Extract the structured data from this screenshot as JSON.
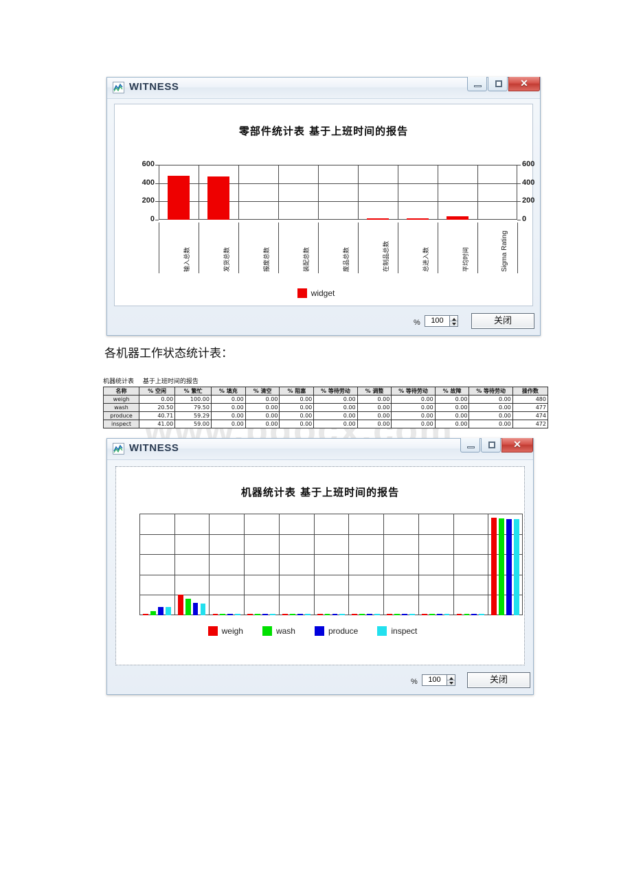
{
  "watermark": "www.bdocx.com",
  "window1": {
    "title": "WITNESS",
    "app_icon": "witness-chart-icon",
    "minimize_label": "",
    "maximize_label": "",
    "close_label": "✕",
    "chart_title": "零部件统计表  基于上班时间的报告",
    "percent_label": "%",
    "zoom_value": "100",
    "close_button_label": "关闭"
  },
  "caption_between": "各机器工作状态统计表：",
  "table": {
    "title_main": "机器统计表",
    "title_sub": "基于上班时间的报告",
    "columns": [
      "名称",
      "% 空闲",
      "% 繁忙",
      "% 填充",
      "% 清空",
      "% 阻塞",
      "% 等待劳动",
      "% 调整",
      "% 等待劳动",
      "% 故障",
      "% 等待劳动",
      "操作数"
    ],
    "rows": [
      {
        "name": "weigh",
        "values": [
          "0.00",
          "100.00",
          "0.00",
          "0.00",
          "0.00",
          "0.00",
          "0.00",
          "0.00",
          "0.00",
          "0.00",
          "480"
        ]
      },
      {
        "name": "wash",
        "values": [
          "20.50",
          "79.50",
          "0.00",
          "0.00",
          "0.00",
          "0.00",
          "0.00",
          "0.00",
          "0.00",
          "0.00",
          "477"
        ]
      },
      {
        "name": "produce",
        "values": [
          "40.71",
          "59.29",
          "0.00",
          "0.00",
          "0.00",
          "0.00",
          "0.00",
          "0.00",
          "0.00",
          "0.00",
          "474"
        ]
      },
      {
        "name": "inspect",
        "values": [
          "41.00",
          "59.00",
          "0.00",
          "0.00",
          "0.00",
          "0.00",
          "0.00",
          "0.00",
          "0.00",
          "0.00",
          "472"
        ]
      }
    ]
  },
  "window2": {
    "title": "WITNESS",
    "app_icon": "witness-chart-icon",
    "close_label": "✕",
    "chart_title": "机器统计表  基于上班时间的报告",
    "percent_label": "%",
    "zoom_value": "100",
    "close_button_label": "关闭"
  },
  "chart_data": [
    {
      "type": "bar",
      "title": "零部件统计表  基于上班时间的报告",
      "xlabel": "",
      "ylabel": "",
      "ylim": [
        0,
        600
      ],
      "yticks": [
        0,
        200,
        400,
        600
      ],
      "grid": true,
      "legend_position": "bottom",
      "categories": [
        "输入总数",
        "发货总数",
        "报废总数",
        "装配总数",
        "废品总数",
        "在制品总数",
        "总进入数",
        "平均时间",
        "Sigma Rating"
      ],
      "series": [
        {
          "name": "widget",
          "color": "#ee0000",
          "values": [
            480,
            472,
            0,
            0,
            0,
            8,
            8,
            40,
            0
          ]
        }
      ]
    },
    {
      "type": "bar",
      "title": "机器统计表  基于上班时间的报告",
      "xlabel": "",
      "ylabel": "",
      "ylim": [
        0,
        500
      ],
      "yticks": [],
      "grid": true,
      "legend_position": "bottom",
      "categories": [
        "% 空闲",
        "% 繁忙",
        "% 填充",
        "% 清空",
        "% 阻塞",
        "% 等待劳动",
        "% 调整",
        "% 等待劳动",
        "% 故障",
        "% 等待劳动",
        "操作数"
      ],
      "series": [
        {
          "name": "weigh",
          "color": "#ee0000",
          "values": [
            0.0,
            100.0,
            0,
            0,
            0,
            0,
            0,
            0,
            0,
            0,
            480
          ]
        },
        {
          "name": "wash",
          "color": "#00e000",
          "values": [
            20.5,
            79.5,
            0,
            0,
            0,
            0,
            0,
            0,
            0,
            0,
            477
          ]
        },
        {
          "name": "produce",
          "color": "#0000dd",
          "values": [
            40.71,
            59.29,
            0,
            0,
            0,
            0,
            0,
            0,
            0,
            0,
            474
          ]
        },
        {
          "name": "inspect",
          "color": "#22e0ee",
          "values": [
            41.0,
            59.0,
            0,
            0,
            0,
            0,
            0,
            0,
            0,
            0,
            472
          ]
        }
      ]
    }
  ]
}
